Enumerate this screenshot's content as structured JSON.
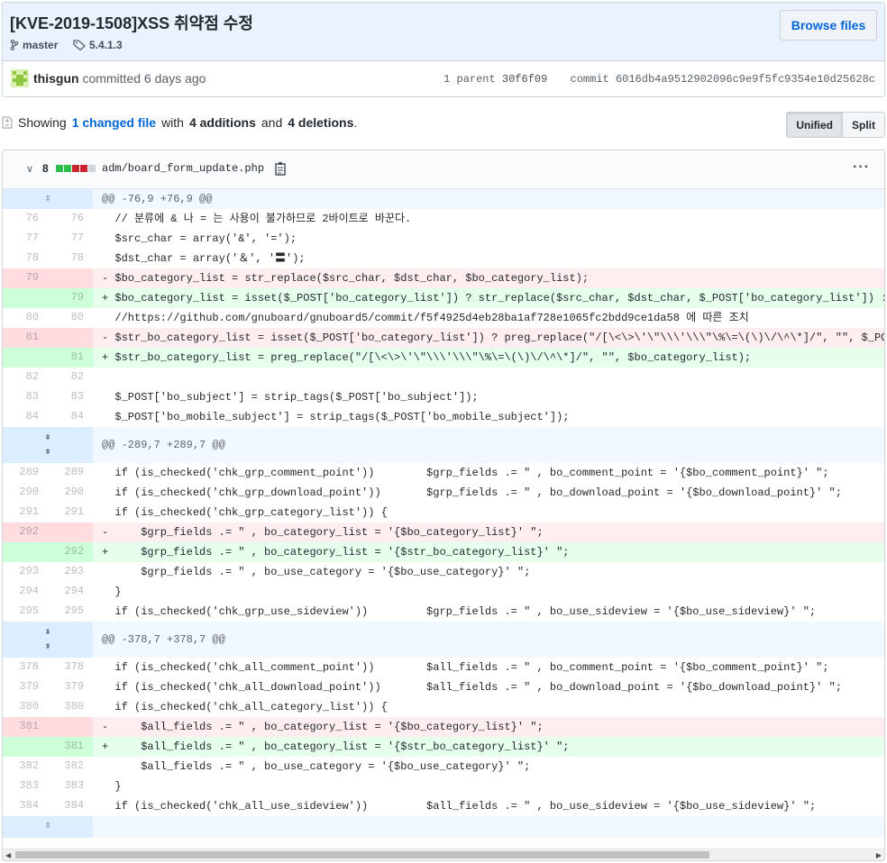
{
  "commit": {
    "title": "[KVE-2019-1508]XSS 취약점 수정",
    "branch": "master",
    "tag": "5.4.1.3",
    "browse_label": "Browse files",
    "author": "thisgun",
    "action": "committed 6 days ago",
    "parent_label": "1 parent",
    "parent_sha": "30f6f09",
    "commit_label": "commit",
    "commit_sha": "6016db4a9512902096c9e9f5fc9354e10d25628c"
  },
  "summary": {
    "showing": "Showing",
    "changed": "1 changed file",
    "with": "with",
    "additions": "4 additions",
    "and": "and",
    "deletions": "4 deletions",
    "period": ".",
    "unified": "Unified",
    "split": "Split"
  },
  "file": {
    "count": "8",
    "name": "adm/board_form_update.php",
    "stat_colors": [
      "#2cbe4e",
      "#2cbe4e",
      "#cb2431",
      "#cb2431",
      "#d1d5da"
    ]
  },
  "colors": {
    "accent": "#0366d6",
    "add_bg": "#e6ffed",
    "del_bg": "#ffeef0"
  },
  "diff": [
    {
      "type": "hunk",
      "text": "@@ -76,9 +76,9 @@"
    },
    {
      "type": "ctx",
      "o": "76",
      "n": "76",
      "text": "  // 분류에 & 나 = 는 사용이 불가하므로 2바이트로 바꾼다."
    },
    {
      "type": "ctx",
      "o": "77",
      "n": "77",
      "text": "  $src_char = array('&', '=');"
    },
    {
      "type": "ctx",
      "o": "78",
      "n": "78",
      "text": "  $dst_char = array('＆', '〓');"
    },
    {
      "type": "del",
      "o": "79",
      "n": "",
      "text": "- $bo_category_list = str_replace($src_char, $dst_char, $bo_category_list);"
    },
    {
      "type": "add",
      "o": "",
      "n": "79",
      "text": "+ $bo_category_list = isset($_POST['bo_category_list']) ? str_replace($src_char, $dst_char, $_POST['bo_category_list']) : '';"
    },
    {
      "type": "ctx",
      "o": "80",
      "n": "80",
      "text": "  //https://github.com/gnuboard/gnuboard5/commit/f5f4925d4eb28ba1af728e1065fc2bdd9ce1da58 에 따른 조치"
    },
    {
      "type": "del",
      "o": "81",
      "n": "",
      "text": "- $str_bo_category_list = isset($_POST['bo_category_list']) ? preg_replace(\"/[\\<\\>\\'\\\"\\\\\\'\\\\\\\"\\%\\=\\(\\)\\/\\^\\*]/\", \"\", $_POST['bo_category_list']) : '';"
    },
    {
      "type": "add",
      "o": "",
      "n": "81",
      "text": "+ $str_bo_category_list = preg_replace(\"/[\\<\\>\\'\\\"\\\\\\'\\\\\\\"\\%\\=\\(\\)\\/\\^\\*]/\", \"\", $bo_category_list);"
    },
    {
      "type": "ctx",
      "o": "82",
      "n": "82",
      "text": ""
    },
    {
      "type": "ctx",
      "o": "83",
      "n": "83",
      "text": "  $_POST['bo_subject'] = strip_tags($_POST['bo_subject']);"
    },
    {
      "type": "ctx",
      "o": "84",
      "n": "84",
      "text": "  $_POST['bo_mobile_subject'] = strip_tags($_POST['bo_mobile_subject']);"
    },
    {
      "type": "hunk2",
      "text": "@@ -289,7 +289,7 @@"
    },
    {
      "type": "ctx",
      "o": "289",
      "n": "289",
      "text": "  if (is_checked('chk_grp_comment_point'))        $grp_fields .= \" , bo_comment_point = '{$bo_comment_point}' \";"
    },
    {
      "type": "ctx",
      "o": "290",
      "n": "290",
      "text": "  if (is_checked('chk_grp_download_point'))       $grp_fields .= \" , bo_download_point = '{$bo_download_point}' \";"
    },
    {
      "type": "ctx",
      "o": "291",
      "n": "291",
      "text": "  if (is_checked('chk_grp_category_list')) {"
    },
    {
      "type": "del",
      "o": "292",
      "n": "",
      "text": "-     $grp_fields .= \" , bo_category_list = '{$bo_category_list}' \";"
    },
    {
      "type": "add",
      "o": "",
      "n": "292",
      "text": "+     $grp_fields .= \" , bo_category_list = '{$str_bo_category_list}' \";"
    },
    {
      "type": "ctx",
      "o": "293",
      "n": "293",
      "text": "      $grp_fields .= \" , bo_use_category = '{$bo_use_category}' \";"
    },
    {
      "type": "ctx",
      "o": "294",
      "n": "294",
      "text": "  }"
    },
    {
      "type": "ctx",
      "o": "295",
      "n": "295",
      "text": "  if (is_checked('chk_grp_use_sideview'))         $grp_fields .= \" , bo_use_sideview = '{$bo_use_sideview}' \";"
    },
    {
      "type": "hunk2",
      "text": "@@ -378,7 +378,7 @@"
    },
    {
      "type": "ctx",
      "o": "378",
      "n": "378",
      "text": "  if (is_checked('chk_all_comment_point'))        $all_fields .= \" , bo_comment_point = '{$bo_comment_point}' \";"
    },
    {
      "type": "ctx",
      "o": "379",
      "n": "379",
      "text": "  if (is_checked('chk_all_download_point'))       $all_fields .= \" , bo_download_point = '{$bo_download_point}' \";"
    },
    {
      "type": "ctx",
      "o": "380",
      "n": "380",
      "text": "  if (is_checked('chk_all_category_list')) {"
    },
    {
      "type": "del",
      "o": "381",
      "n": "",
      "text": "-     $all_fields .= \" , bo_category_list = '{$bo_category_list}' \";"
    },
    {
      "type": "add",
      "o": "",
      "n": "381",
      "text": "+     $all_fields .= \" , bo_category_list = '{$str_bo_category_list}' \";"
    },
    {
      "type": "ctx",
      "o": "382",
      "n": "382",
      "text": "      $all_fields .= \" , bo_use_category = '{$bo_use_category}' \";"
    },
    {
      "type": "ctx",
      "o": "383",
      "n": "383",
      "text": "  }"
    },
    {
      "type": "ctx",
      "o": "384",
      "n": "384",
      "text": "  if (is_checked('chk_all_use_sideview'))         $all_fields .= \" , bo_use_sideview = '{$bo_use_sideview}' \";"
    },
    {
      "type": "hunkend",
      "text": ""
    }
  ]
}
